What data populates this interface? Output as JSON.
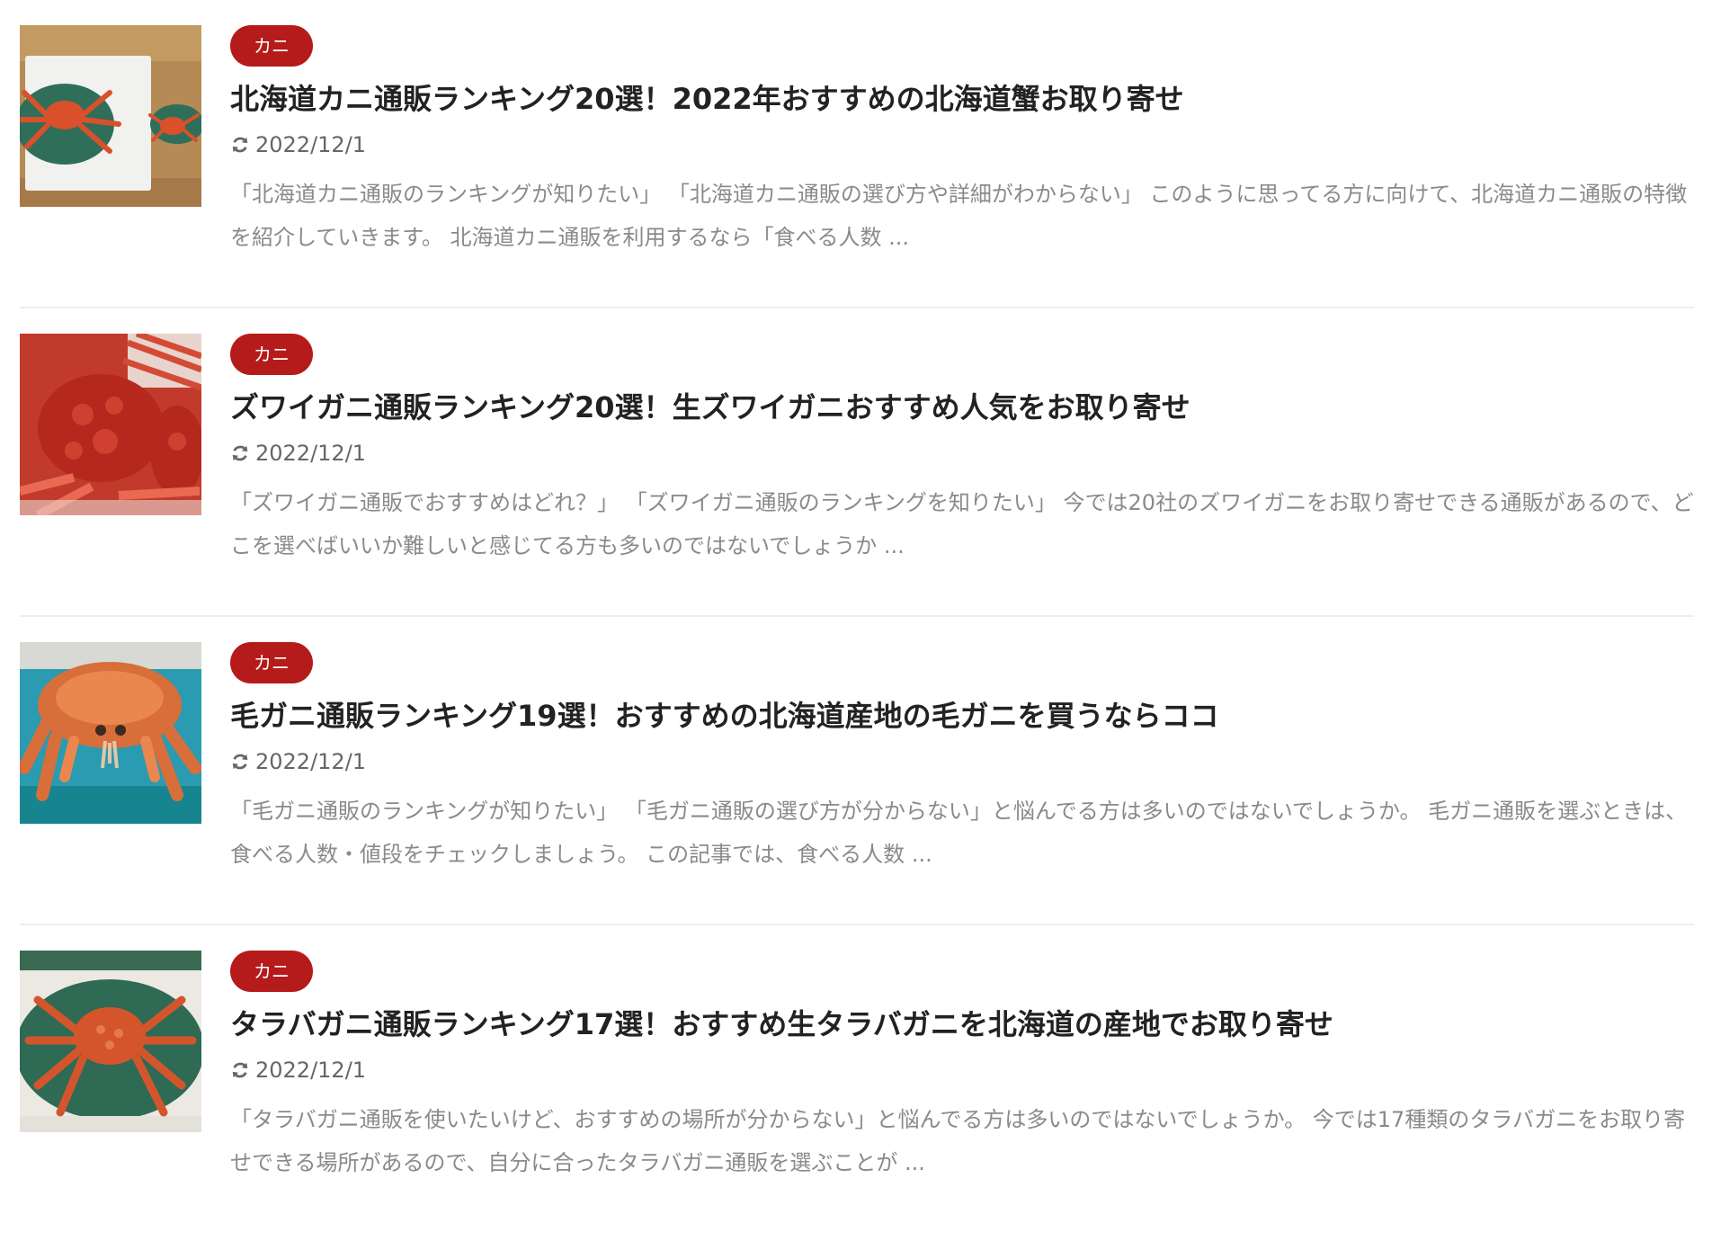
{
  "theme": {
    "badge_color": "#b51b1b",
    "title_color": "#222222",
    "excerpt_color": "#8a8a8a",
    "meta_color": "#666666"
  },
  "posts": [
    {
      "category": "カニ",
      "title": "北海道カニ通販ランキング20選！2022年おすすめの北海道蟹お取り寄せ",
      "date": "2022/12/1",
      "date_icon": "refresh-icon",
      "excerpt": "「北海道カニ通販のランキングが知りたい」 「北海道カニ通販の選び方や詳細がわからない」 このように思ってる方に向けて、北海道カニ通販の特徴を紹介していきます。 北海道カニ通販を利用するなら「食べる人数 ...",
      "thumbnail": "crab-on-tray-wooden-floor"
    },
    {
      "category": "カニ",
      "title": "ズワイガニ通販ランキング20選！生ズワイガニおすすめ人気をお取り寄せ",
      "date": "2022/12/1",
      "date_icon": "refresh-icon",
      "excerpt": "「ズワイガニ通販でおすすめはどれ？」 「ズワイガニ通販のランキングを知りたい」 今では20社のズワイガニをお取り寄せできる通販があるので、どこを選べばいいか難しいと感じてる方も多いのではないでしょうか ...",
      "thumbnail": "red-snow-crab-closeup"
    },
    {
      "category": "カニ",
      "title": "毛ガニ通販ランキング19選！おすすめの北海道産地の毛ガニを買うならココ",
      "date": "2022/12/1",
      "date_icon": "refresh-icon",
      "excerpt": "「毛ガニ通販のランキングが知りたい」 「毛ガニ通販の選び方が分からない」と悩んでる方は多いのではないでしょうか。 毛ガニ通販を選ぶときは、食べる人数・値段をチェックしましょう。 この記事では、食べる人数 ...",
      "thumbnail": "hairy-crab-on-blue-cloth"
    },
    {
      "category": "カニ",
      "title": "タラバガニ通販ランキング17選！おすすめ生タラバガニを北海道の産地でお取り寄せ",
      "date": "2022/12/1",
      "date_icon": "refresh-icon",
      "excerpt": "「タラバガニ通販を使いたいけど、おすすめの場所が分からない」と悩んでる方は多いのではないでしょうか。 今では17種類のタラバガニをお取り寄せできる場所があるので、自分に合ったタラバガニ通販を選ぶことが ...",
      "thumbnail": "king-crab-on-green-cloth"
    }
  ]
}
